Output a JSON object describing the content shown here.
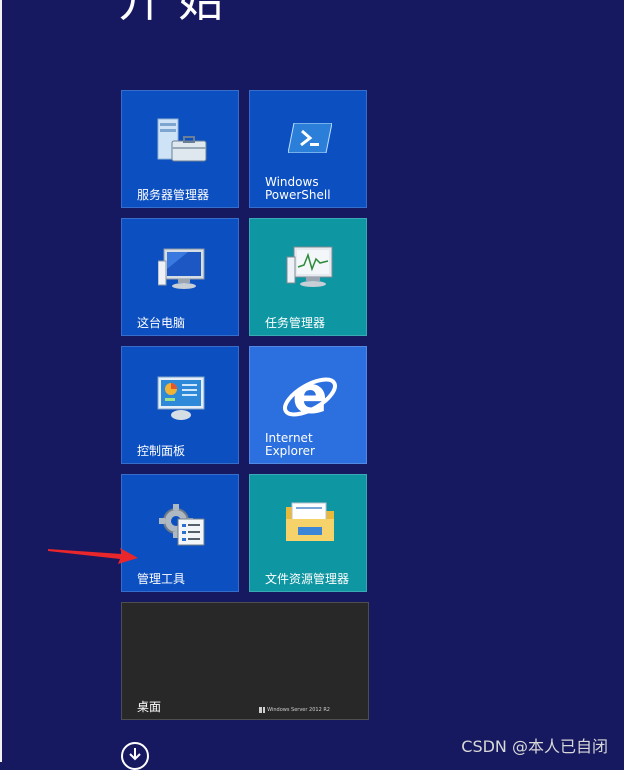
{
  "start": {
    "title": "开始"
  },
  "tiles": [
    {
      "id": "server-manager",
      "label": "服务器管理器",
      "color": "#0c4fc1",
      "icon": "server-manager-icon"
    },
    {
      "id": "powershell",
      "label": "Windows\nPowerShell",
      "color": "#0c4fc1",
      "icon": "powershell-icon"
    },
    {
      "id": "this-pc",
      "label": "这台电脑",
      "color": "#0c4fc1",
      "icon": "computer-icon"
    },
    {
      "id": "task-manager",
      "label": "任务管理器",
      "color": "#0e96a3",
      "icon": "task-manager-icon"
    },
    {
      "id": "control-panel",
      "label": "控制面板",
      "color": "#0c4fc1",
      "icon": "control-panel-icon"
    },
    {
      "id": "internet-explorer",
      "label": "Internet\nExplorer",
      "color": "#2c6fde",
      "icon": "internet-explorer-icon"
    },
    {
      "id": "admin-tools",
      "label": "管理工具",
      "color": "#0c4fc1",
      "icon": "admin-tools-icon"
    },
    {
      "id": "file-explorer",
      "label": "文件资源管理器",
      "color": "#0e96a3",
      "icon": "folder-icon"
    },
    {
      "id": "desktop",
      "label": "桌面",
      "color": "#282828",
      "badge": "Windows Server 2012 R2"
    }
  ],
  "watermark": "CSDN @本人已自闭"
}
